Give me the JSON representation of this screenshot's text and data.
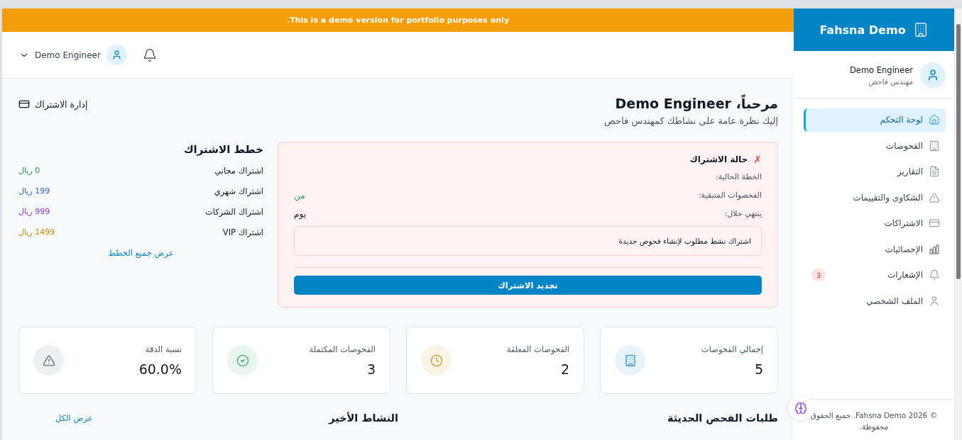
{
  "banner": {
    "text": "This is a demo version for portfolio purposes only."
  },
  "header": {
    "user_name": "Demo Engineer"
  },
  "welcome": {
    "title": "مرحباً، Demo Engineer",
    "subtitle": "إليك نظرة عامة على نشاطك كمهندس فاحص",
    "manage_link": "إدارة الاشتراك"
  },
  "subscription_status": {
    "title": "حالة الاشتراك",
    "mark": "✗",
    "active": false,
    "rows": [
      {
        "label": "الخطة الحالية:"
      },
      {
        "label": "الفحصوات المتبقية:",
        "value": "من",
        "kind": "good"
      },
      {
        "label": "ينتهي خلال:",
        "value": "يوم",
        "kind": "plain"
      }
    ],
    "notice": "اشتراك نشط مطلوب لإنشاء فحوص جديدة",
    "button": "تجديد الاشتراك"
  },
  "plans": {
    "title": "خطط الاشتراك",
    "items": [
      {
        "name": "اشتراك مجاني",
        "price": "0 ريال",
        "color": "#16a34a"
      },
      {
        "name": "اشتراك شهري",
        "price": "199 ريال",
        "color": "#2563eb"
      },
      {
        "name": "اشتراك الشركات",
        "price": "999 ريال",
        "color": "#9333ea"
      },
      {
        "name": "اشتراك VIP",
        "price": "1499 ريال",
        "color": "#ca8a04"
      }
    ],
    "link": "عرض جميع الخطط"
  },
  "stats": [
    {
      "label": "إجمالي الفحوصات",
      "value": "5",
      "color": "#0284c7"
    },
    {
      "label": "الفحوصات المعلقة",
      "value": "2",
      "color": "#ca8a04"
    },
    {
      "label": "الفحوصات المكتملة",
      "value": "3",
      "color": "#16a34a"
    },
    {
      "label": "نسبة الدقة",
      "value": "60.0%",
      "color": "#4b5563"
    }
  ],
  "sections": {
    "recent_requests": "طلبات الفحص الحديثة",
    "recent_activity": "النشاط الأخير",
    "view_all": "عرض الكل"
  },
  "sidebar": {
    "brand": "Fahsna Demo",
    "user_name": "Demo Engineer",
    "user_role": "مهندس فاحص",
    "items": [
      {
        "label": "لوحة التحكم",
        "selected": true
      },
      {
        "label": "الفحوصات",
        "selected": false
      },
      {
        "label": "التقارير",
        "selected": false
      },
      {
        "label": "الشكاوى والتقييمات",
        "selected": false
      },
      {
        "label": "الاشتراكات",
        "selected": false
      },
      {
        "label": "الإحصائيات",
        "selected": false
      },
      {
        "label": "الإشعارات",
        "selected": false,
        "badge": "3"
      },
      {
        "label": "الملف الشخصي",
        "selected": false
      }
    ],
    "footer": "© Fahsna Demo 2026. جميع الحقوق محفوظة."
  }
}
